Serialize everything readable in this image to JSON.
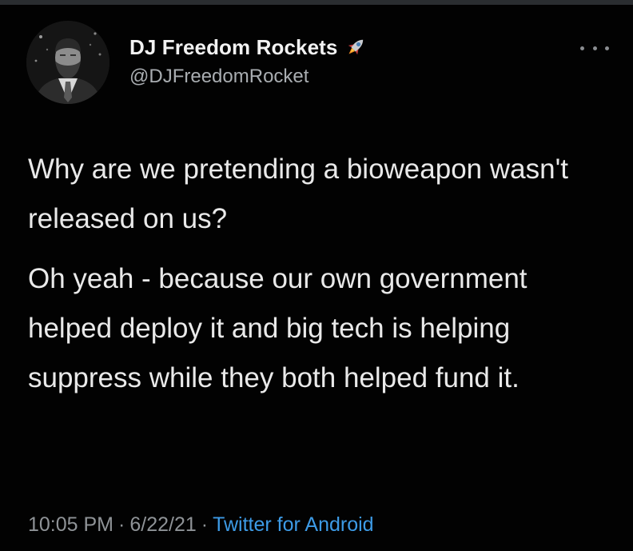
{
  "tweet": {
    "display_name": "DJ Freedom Rockets",
    "handle": "@DJFreedomRocket",
    "paragraphs": [
      "Why are we pretending a bioweapon wasn't released on us?",
      "Oh yeah - because our own government helped deploy it and big tech is helping suppress while they both helped fund it."
    ],
    "time": "10:05 PM",
    "date": "6/22/21",
    "separator": "·",
    "source": "Twitter for Android"
  },
  "icons": {
    "name_emoji": "rocket-icon",
    "menu": "more-options-icon",
    "avatar": "profile-photo"
  },
  "colors": {
    "background": "#020202",
    "text": "#e9e9e9",
    "secondary_text": "#8f9397",
    "link": "#3d9be6"
  }
}
